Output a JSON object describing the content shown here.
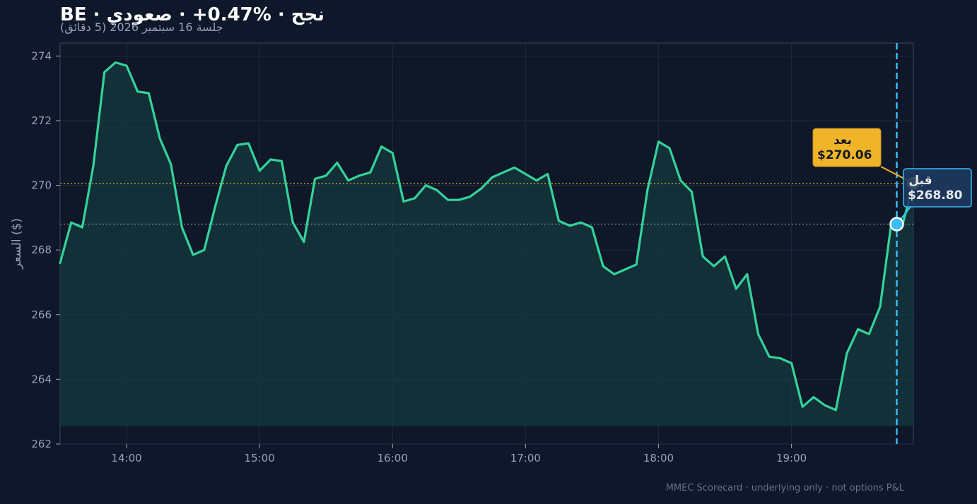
{
  "header": {
    "title": "BE · نجح · %0.47+ · صعودي",
    "subtitle": "جلسة 16 سبتمبر 2026 (5 دقائق)"
  },
  "footer": "MMEC Scorecard · underlying only · not options P&L",
  "colors": {
    "background": "#0f172a",
    "plot_bg": "#0f1729",
    "line": "#34d399",
    "area": "#163a3d",
    "after": "#f0b429",
    "before": "#38bdf8",
    "before_box": "#1e3a5f",
    "grid": "#1f2a3d",
    "tick": "#94a3b8"
  },
  "chart_data": {
    "type": "line",
    "title": "BE · نجح · %0.47+ · صعودي",
    "subtitle": "جلسة 16 سبتمبر 2026 (5 دقائق)",
    "xlabel": "",
    "ylabel": "السعر ($)",
    "x_ticks": [
      "14:00",
      "15:00",
      "16:00",
      "17:00",
      "18:00",
      "19:00"
    ],
    "x_tick_minutes": [
      840,
      900,
      960,
      1020,
      1080,
      1140
    ],
    "xlim_minutes": [
      810,
      1195
    ],
    "ylim": [
      262,
      274.4
    ],
    "y_ticks": [
      262,
      264,
      266,
      268,
      270,
      272,
      274
    ],
    "grid": true,
    "area_baseline": 262.55,
    "x_start_minutes": 810,
    "x_step_minutes": 5,
    "values": [
      267.6,
      268.85,
      268.7,
      270.6,
      273.5,
      273.8,
      273.7,
      272.9,
      272.85,
      271.45,
      270.65,
      268.7,
      267.85,
      268.0,
      269.35,
      270.6,
      271.25,
      271.3,
      270.45,
      270.8,
      270.75,
      268.85,
      268.25,
      270.2,
      270.3,
      270.7,
      270.15,
      270.3,
      270.4,
      271.2,
      271.0,
      269.5,
      269.6,
      270.0,
      269.85,
      269.55,
      269.55,
      269.65,
      269.9,
      270.25,
      270.4,
      270.55,
      270.35,
      270.15,
      270.35,
      268.9,
      268.75,
      268.85,
      268.7,
      267.5,
      267.25,
      267.4,
      267.55,
      269.85,
      271.35,
      271.15,
      270.15,
      269.8,
      267.8,
      267.5,
      267.8,
      266.8,
      267.25,
      265.4,
      264.7,
      264.65,
      264.5,
      263.15,
      263.45,
      263.2,
      263.05,
      264.8,
      265.55,
      265.4,
      266.25,
      268.8,
      268.75,
      270.06
    ],
    "before_after": {
      "entry_time_minutes": 1187.5,
      "after_label": "بعد",
      "after_value": 270.06,
      "after_text": "$270.06",
      "before_label": "قبل",
      "before_value": 268.8,
      "before_text": "$268.80"
    }
  }
}
